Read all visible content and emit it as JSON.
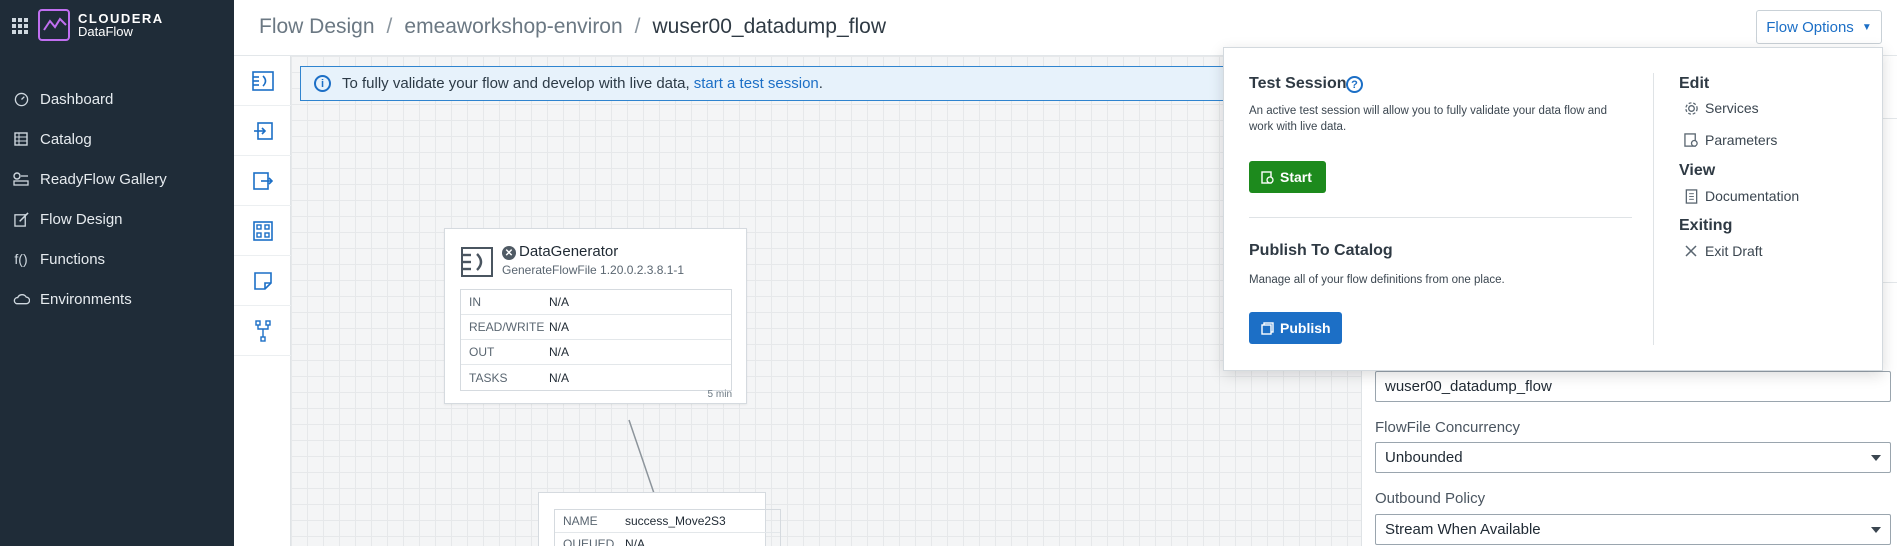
{
  "brand": {
    "line1": "CLOUDERA",
    "line2": "DataFlow",
    "accent": "#c06ff0"
  },
  "nav": {
    "items": [
      {
        "label": "Dashboard",
        "icon": "gauge-icon"
      },
      {
        "label": "Catalog",
        "icon": "catalog-icon"
      },
      {
        "label": "ReadyFlow Gallery",
        "icon": "readyflow-icon"
      },
      {
        "label": "Flow Design",
        "icon": "edit-icon"
      },
      {
        "label": "Functions",
        "icon": "function-icon"
      },
      {
        "label": "Environments",
        "icon": "cloud-icon"
      }
    ]
  },
  "header": {
    "breadcrumbs": [
      "Flow Design",
      "emeaworkshop-environ",
      "wuser00_datadump_flow"
    ],
    "separator": "/",
    "flow_options_label": "Flow Options"
  },
  "banner": {
    "text": "To fully validate your flow and develop with live data,",
    "link": "start a test session",
    "suffix": "."
  },
  "processor": {
    "name": "DataGenerator",
    "type": "GenerateFlowFile 1.20.0.2.3.8.1-1",
    "stats": [
      {
        "key": "IN",
        "value": "N/A"
      },
      {
        "key": "READ/WRITE",
        "value": "N/A"
      },
      {
        "key": "OUT",
        "value": "N/A"
      },
      {
        "key": "TASKS",
        "value": "N/A"
      }
    ],
    "time": "5 min"
  },
  "connection": {
    "rows": [
      {
        "key": "NAME",
        "value": "success_Move2S3"
      },
      {
        "key": "QUEUED",
        "value": "N/A"
      }
    ]
  },
  "menu": {
    "test_session": {
      "title": "Test Session",
      "help": "?",
      "description": "An active test session will allow you to fully validate your data flow and work with live data.",
      "button": "Start",
      "button_color": "#1d8a1d"
    },
    "publish": {
      "title": "Publish To Catalog",
      "description": "Manage all of your flow definitions from one place.",
      "button": "Publish",
      "button_color": "#1c6fc6"
    },
    "edit": {
      "title": "Edit",
      "items": [
        {
          "label": "Services",
          "icon": "gear-icon"
        },
        {
          "label": "Parameters",
          "icon": "parameters-icon"
        }
      ]
    },
    "view": {
      "title": "View",
      "items": [
        {
          "label": "Documentation",
          "icon": "document-icon"
        }
      ]
    },
    "exiting": {
      "title": "Exiting",
      "items": [
        {
          "label": "Exit Draft",
          "icon": "close-icon"
        }
      ]
    }
  },
  "panel": {
    "flow_name_value": "wuser00_datadump_flow",
    "concurrency_label": "FlowFile Concurrency",
    "concurrency_value": "Unbounded",
    "outbound_label": "Outbound Policy",
    "outbound_value": "Stream When Available"
  }
}
